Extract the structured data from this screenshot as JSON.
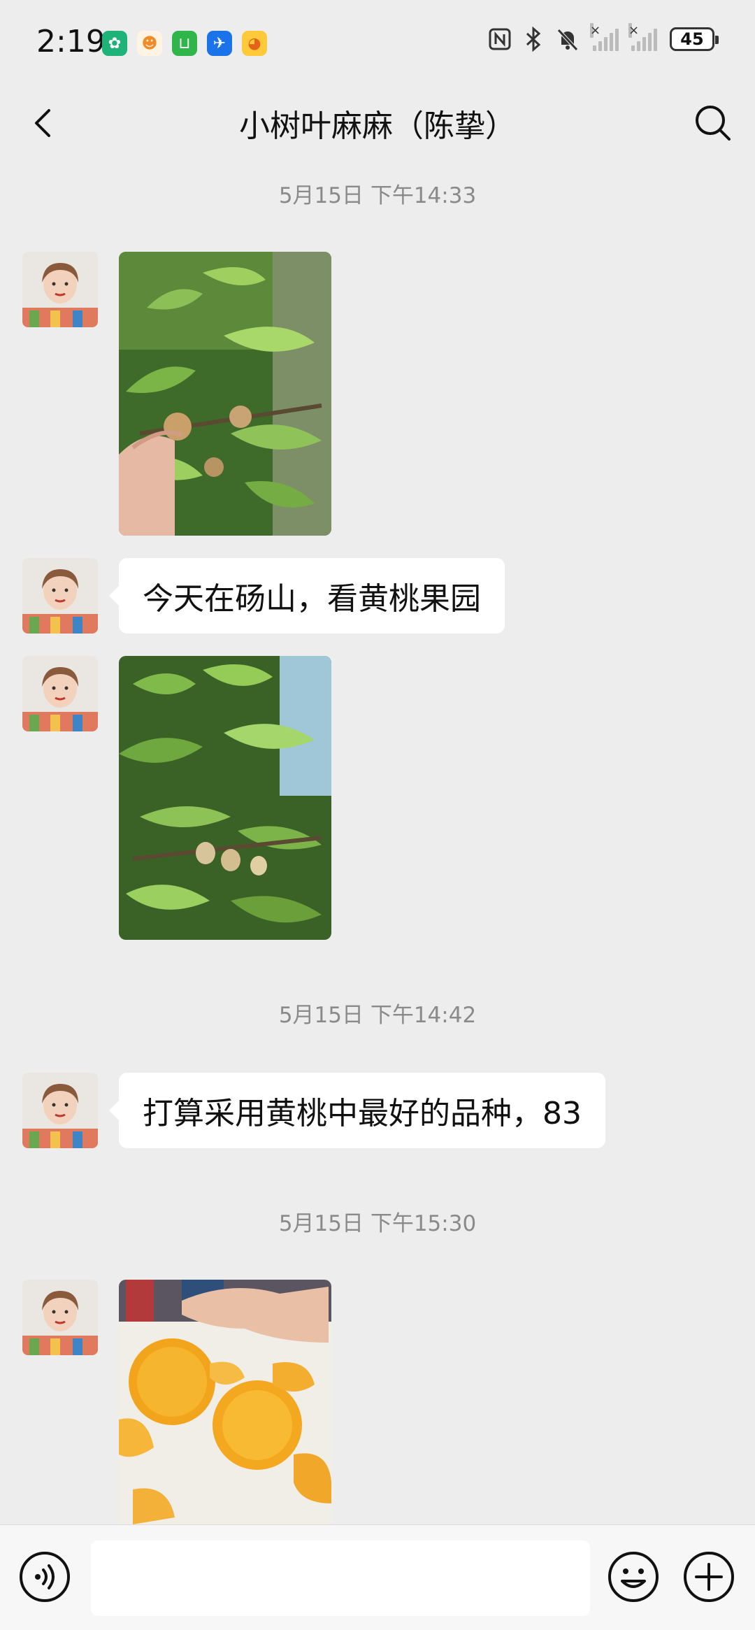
{
  "status_bar": {
    "time": "2:19",
    "battery_level": "45",
    "app_icons": [
      "green-leaf-app-icon",
      "orange-mascot-app-icon",
      "green-delivery-app-icon",
      "blue-plane-app-icon",
      "yellow-duck-app-icon"
    ],
    "system_icons": [
      "nfc-icon",
      "bluetooth-icon",
      "mute-bell-icon",
      "signal-no-service-icon",
      "signal-no-service-icon",
      "battery-icon"
    ]
  },
  "header": {
    "title": "小树叶麻麻（陈挚）",
    "back_icon": "chevron-left-icon",
    "search_icon": "search-icon"
  },
  "messages": {
    "sep1": "5月15日 下午14:33",
    "text1": "今天在砀山，看黄桃果园",
    "sep2": "5月15日 下午14:42",
    "text2": "打算采用黄桃中最好的品种，83",
    "sep3": "5月15日 下午15:30",
    "images": [
      "peach-tree-branch-photo",
      "peach-tree-leaves-photo",
      "canned-yellow-peach-photo"
    ]
  },
  "input_bar": {
    "value": "",
    "voice_icon": "voice-icon",
    "emoji_icon": "emoji-icon",
    "plus_icon": "plus-circle-icon"
  },
  "colors": {
    "background": "#ededed",
    "bubble": "#ffffff",
    "timestamp": "#8a8a8a"
  }
}
